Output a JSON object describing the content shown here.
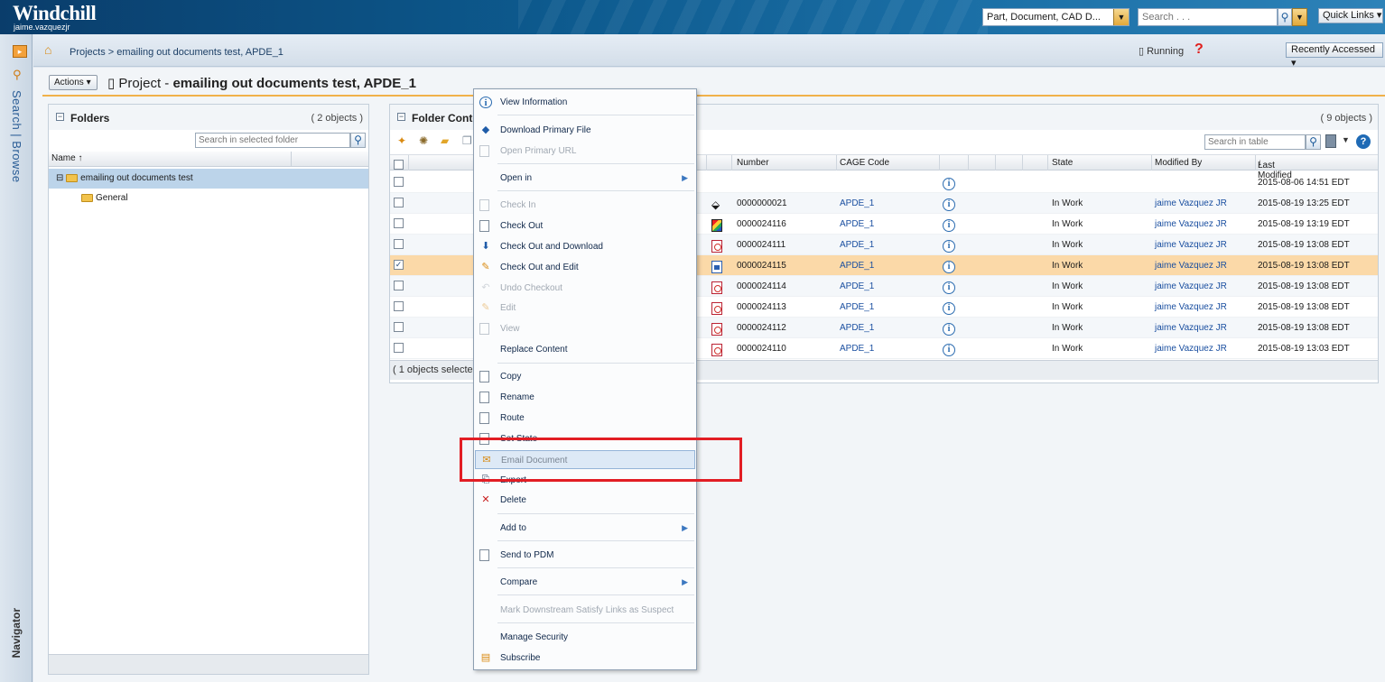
{
  "banner": {
    "logo": "Windchill",
    "user": "jaime.vazquezjr",
    "type_select": "Part, Document, CAD D...",
    "search_placeholder": "Search . . .",
    "quick_links": "Quick Links"
  },
  "navigator": {
    "vertical_links": "Search | Browse",
    "label": "Navigator"
  },
  "crumbbar": {
    "breadcrumb": "Projects > emailing out documents test, APDE_1",
    "running": "Running",
    "recently_accessed": "Recently Accessed"
  },
  "page": {
    "actions": "Actions",
    "title_prefix": "Project - ",
    "title_bold": "emailing out documents test, APDE_1"
  },
  "folders": {
    "title": "Folders",
    "count": "( 2 objects )",
    "search_placeholder": "Search in selected folder",
    "name_column": "Name",
    "root": "emailing out documents test",
    "child": "General"
  },
  "contents": {
    "title": "Folder Contents",
    "count": "( 9 objects )",
    "search_placeholder": "Search in table",
    "columns": {
      "number": "Number",
      "cage": "CAGE Code",
      "state": "State",
      "modified_by": "Modified By",
      "last_modified": "Last Modified"
    },
    "rows": [
      {
        "type": "",
        "number": "",
        "cage": "",
        "state": "",
        "modified_by": "",
        "last_modified": "2015-08-06 14:51 EDT",
        "checked": false
      },
      {
        "type": "cad",
        "number": "0000000021",
        "cage": "APDE_1",
        "state": "In Work",
        "modified_by": "jaime Vazquez JR",
        "last_modified": "2015-08-19 13:25 EDT",
        "checked": false
      },
      {
        "type": "img",
        "number": "0000024116",
        "cage": "APDE_1",
        "state": "In Work",
        "modified_by": "jaime Vazquez JR",
        "last_modified": "2015-08-19 13:19 EDT",
        "checked": false
      },
      {
        "type": "pdf",
        "number": "0000024111",
        "cage": "APDE_1",
        "state": "In Work",
        "modified_by": "jaime Vazquez JR",
        "last_modified": "2015-08-19 13:08 EDT",
        "checked": false
      },
      {
        "type": "doc",
        "number": "0000024115",
        "cage": "APDE_1",
        "state": "In Work",
        "modified_by": "jaime Vazquez JR",
        "last_modified": "2015-08-19 13:08 EDT",
        "checked": true
      },
      {
        "type": "pdf",
        "number": "0000024114",
        "cage": "APDE_1",
        "state": "In Work",
        "modified_by": "jaime Vazquez JR",
        "last_modified": "2015-08-19 13:08 EDT",
        "checked": false
      },
      {
        "type": "pdf",
        "number": "0000024113",
        "cage": "APDE_1",
        "state": "In Work",
        "modified_by": "jaime Vazquez JR",
        "last_modified": "2015-08-19 13:08 EDT",
        "checked": false
      },
      {
        "type": "pdf",
        "number": "0000024112",
        "cage": "APDE_1",
        "state": "In Work",
        "modified_by": "jaime Vazquez JR",
        "last_modified": "2015-08-19 13:08 EDT",
        "checked": false
      },
      {
        "type": "pdf",
        "number": "0000024110",
        "cage": "APDE_1",
        "state": "In Work",
        "modified_by": "jaime Vazquez JR",
        "last_modified": "2015-08-19 13:03 EDT",
        "checked": false
      }
    ],
    "footer": "( 1 objects selected )"
  },
  "menu": {
    "items": [
      "View Information",
      "Download Primary File",
      "Open Primary URL",
      "Open in",
      "Check In",
      "Check Out",
      "Check Out and Download",
      "Check Out and Edit",
      "Undo Checkout",
      "Edit",
      "View",
      "Replace Content",
      "Copy",
      "Rename",
      "Route",
      "Set State",
      "Email Document",
      "Export",
      "Delete",
      "Add to",
      "Send to PDM",
      "Compare",
      "Mark Downstream Satisfy Links as Suspect",
      "Manage Security",
      "Subscribe"
    ]
  },
  "colors": {
    "banner": "#0d5a8e",
    "accent_orange": "#f0b14a",
    "selected_row": "#fbd9a8",
    "highlight_box": "#e21d24"
  }
}
